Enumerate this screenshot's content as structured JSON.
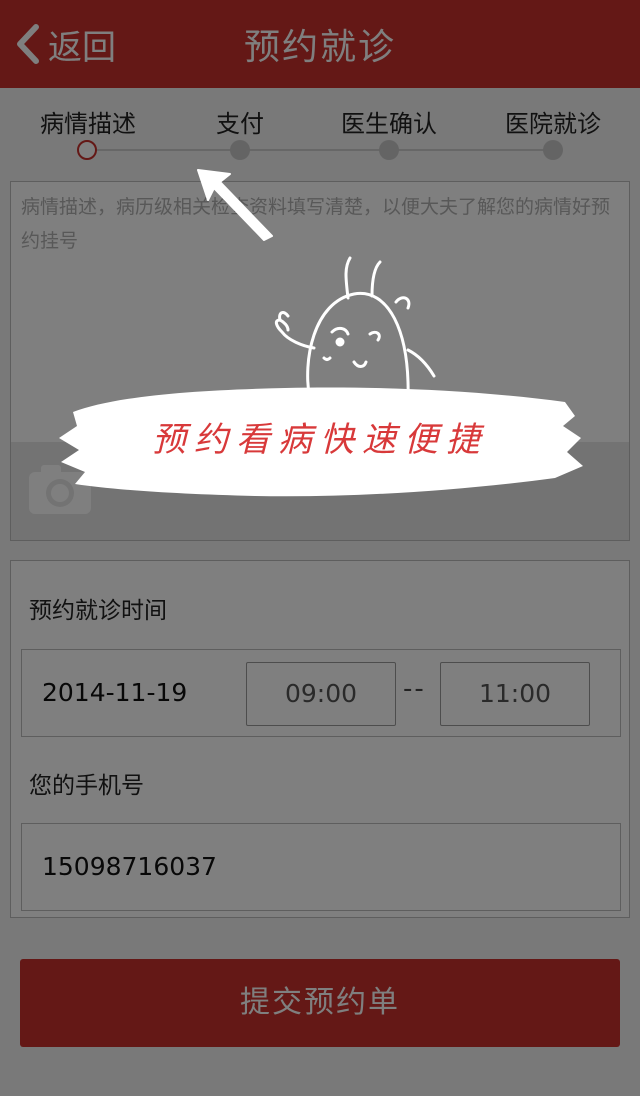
{
  "header": {
    "back_label": "返回",
    "title": "预约就诊"
  },
  "steps": [
    {
      "label": "病情描述",
      "active": true
    },
    {
      "label": "支付",
      "active": false
    },
    {
      "label": "医生确认",
      "active": false
    },
    {
      "label": "医院就诊",
      "active": false
    }
  ],
  "description": {
    "placeholder": "病情描述，病历级相关检查资料填写清楚，以便大夫了解您的病情好预约挂号"
  },
  "appointment": {
    "time_label": "预约就诊时间",
    "date": "2014-11-19",
    "start_time": "09:00",
    "separator": "--",
    "end_time": "11:00",
    "phone_label": "您的手机号",
    "phone": "15098716037"
  },
  "submit_label": "提交预约单",
  "overlay": {
    "slogan": "预约看病快速便捷"
  },
  "colors": {
    "brand": "#c8312c",
    "overlay_text": "#d8393a"
  }
}
